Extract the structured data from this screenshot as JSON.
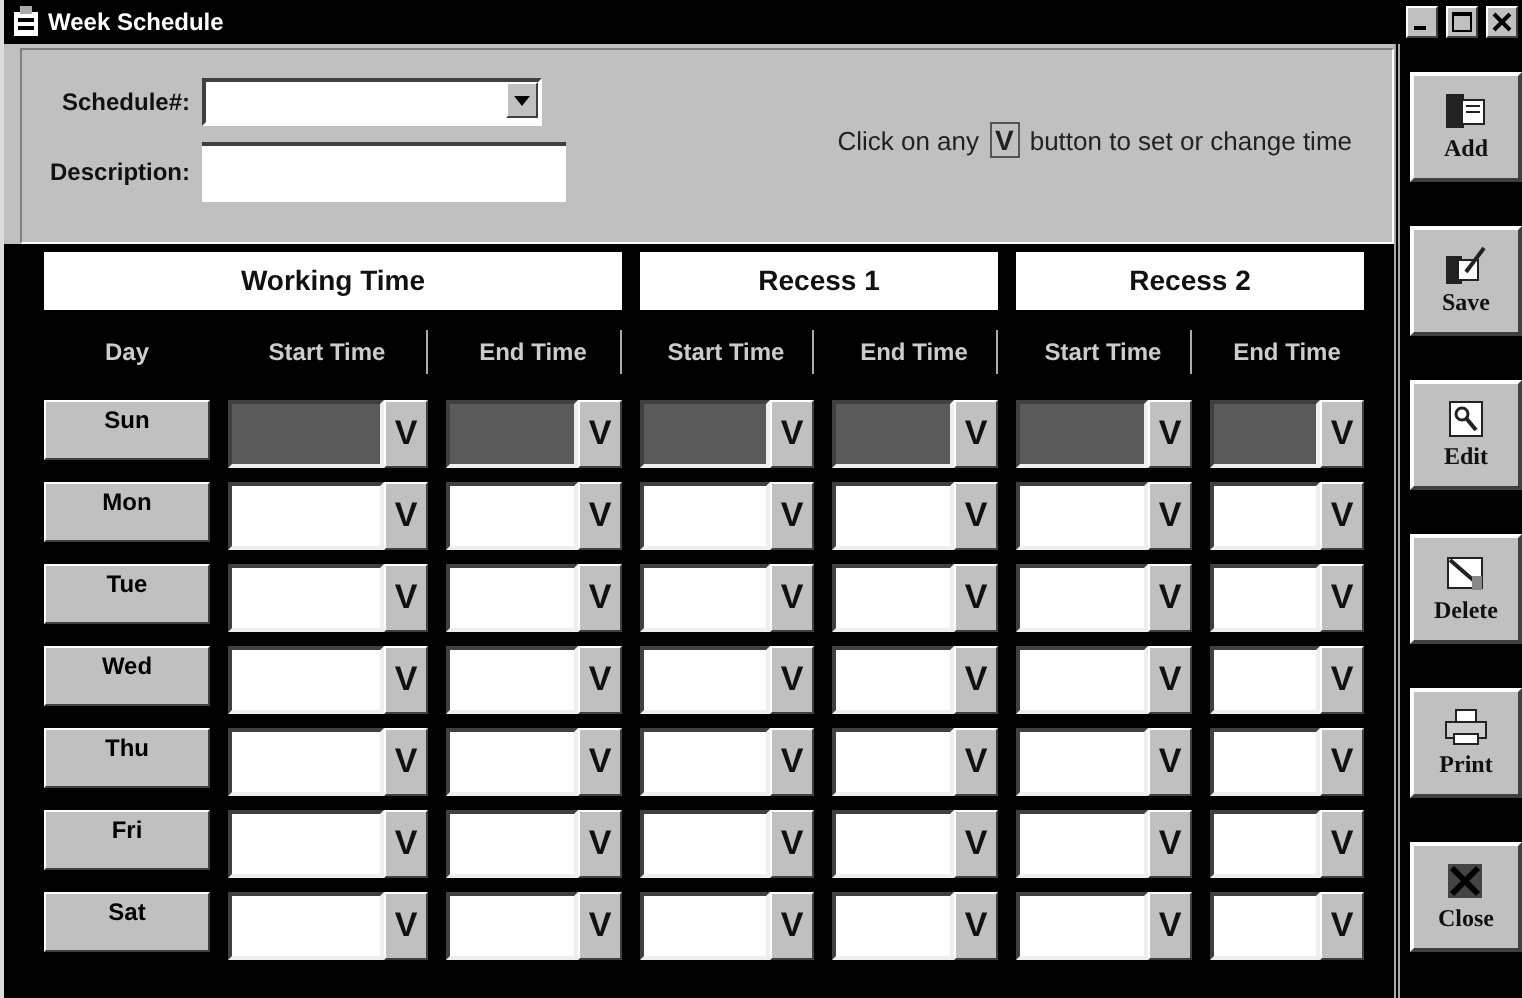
{
  "window": {
    "title": "Week Schedule"
  },
  "form": {
    "schedule_label": "Schedule#:",
    "description_label": "Description:",
    "hint_before": "Click on any",
    "hint_key": "V",
    "hint_after": "button to set or change time"
  },
  "groups": [
    "Working Time",
    "Recess 1",
    "Recess 2"
  ],
  "columns": [
    "Day",
    "Start Time",
    "End Time",
    "Start Time",
    "End Time",
    "Start Time",
    "End Time"
  ],
  "rows": [
    {
      "day": "Sun",
      "disabled": true,
      "buttons": [
        "V",
        "V",
        "V",
        "V",
        "V",
        "V"
      ]
    },
    {
      "day": "Mon",
      "disabled": false,
      "buttons": [
        "V",
        "V",
        "V",
        "V",
        "V",
        "V"
      ]
    },
    {
      "day": "Tue",
      "disabled": false,
      "buttons": [
        "V",
        "V",
        "V",
        "V",
        "V",
        "V"
      ]
    },
    {
      "day": "Wed",
      "disabled": false,
      "buttons": [
        "V",
        "V",
        "V",
        "V",
        "V",
        "V"
      ]
    },
    {
      "day": "Thu",
      "disabled": false,
      "buttons": [
        "V",
        "V",
        "V",
        "V",
        "V",
        "V"
      ]
    },
    {
      "day": "Fri",
      "disabled": false,
      "buttons": [
        "V",
        "V",
        "V",
        "V",
        "V",
        "V"
      ]
    },
    {
      "day": "Sat",
      "disabled": false,
      "buttons": [
        "V",
        "V",
        "V",
        "V",
        "V",
        "V"
      ]
    }
  ],
  "toolbar": [
    {
      "label": "Add",
      "kind": "add"
    },
    {
      "label": "Save",
      "kind": "save"
    },
    {
      "label": "Edit",
      "kind": "edit"
    },
    {
      "label": "Delete",
      "kind": "delete"
    },
    {
      "label": "Print",
      "kind": "print"
    },
    {
      "label": "Close",
      "kind": "close"
    }
  ]
}
